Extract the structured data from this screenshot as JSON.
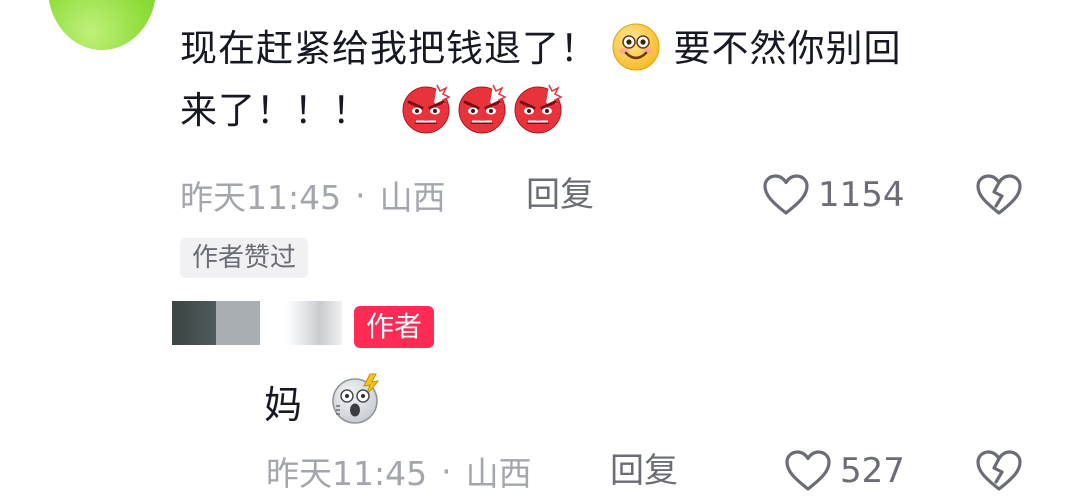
{
  "comment": {
    "text_line1_a": "现在赶紧给我把钱退了！",
    "text_line1_b": "要不然你别回",
    "text_line2": "来了！！！",
    "time": "昨天11:45",
    "separator": "·",
    "location": "山西",
    "reply_label": "回复",
    "like_count": "1154",
    "author_liked_label": "作者赞过",
    "emojis": [
      "smile-emoji",
      "angry-emoji",
      "angry-emoji",
      "angry-emoji"
    ]
  },
  "reply": {
    "author_badge": "作者",
    "text": "妈",
    "emoji": "shocked-emoji",
    "time": "昨天11:45",
    "separator": "·",
    "location": "山西",
    "reply_label": "回复",
    "like_count": "527"
  },
  "colors": {
    "text_primary": "#161823",
    "text_secondary": "#a3a6ad",
    "action_gray": "#6b6d76",
    "author_badge_bg": "#fe2c55",
    "liked_tag_bg": "#f1f1f3",
    "avatar_green": "#8fdc3a"
  },
  "icons": {
    "like": "heart-outline-icon",
    "dislike": "broken-heart-icon"
  }
}
